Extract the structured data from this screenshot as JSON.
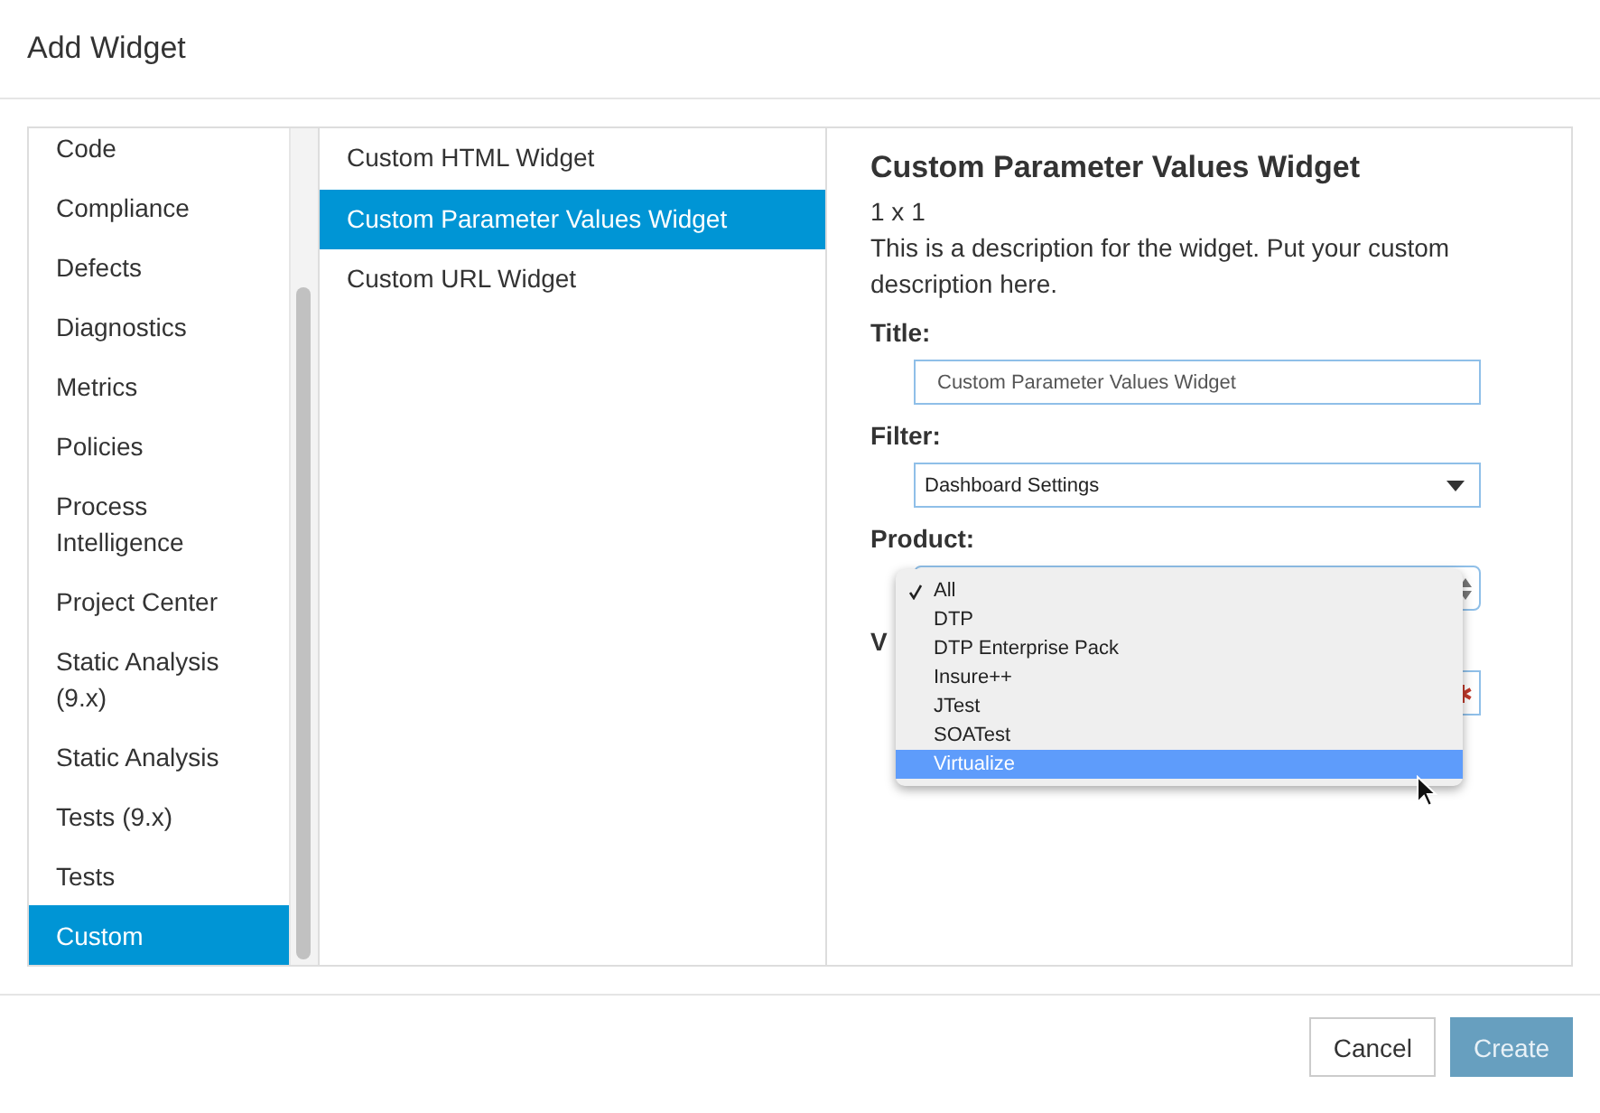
{
  "dialog": {
    "title": "Add Widget"
  },
  "categories": [
    {
      "label": "Code",
      "selected": false
    },
    {
      "label": "Compliance",
      "selected": false
    },
    {
      "label": "Defects",
      "selected": false
    },
    {
      "label": "Diagnostics",
      "selected": false
    },
    {
      "label": "Metrics",
      "selected": false
    },
    {
      "label": "Policies",
      "selected": false
    },
    {
      "label": "Process Intelligence",
      "selected": false
    },
    {
      "label": "Project Center",
      "selected": false
    },
    {
      "label": "Static Analysis (9.x)",
      "selected": false
    },
    {
      "label": "Static Analysis",
      "selected": false
    },
    {
      "label": "Tests (9.x)",
      "selected": false
    },
    {
      "label": "Tests",
      "selected": false
    },
    {
      "label": "Custom",
      "selected": true
    }
  ],
  "widgets": [
    {
      "label": "Custom HTML Widget",
      "selected": false
    },
    {
      "label": "Custom Parameter Values Widget",
      "selected": true
    },
    {
      "label": "Custom URL Widget",
      "selected": false
    }
  ],
  "detail": {
    "name": "Custom Parameter Values Widget",
    "size": "1 x 1",
    "description": "This is a description for the widget. Put your custom description here."
  },
  "form": {
    "title_label": "Title:",
    "title_value": "Custom Parameter Values Widget",
    "filter_label": "Filter:",
    "filter_value": "Dashboard Settings",
    "product_label": "Product:",
    "hidden_label": "V"
  },
  "product_menu": [
    {
      "label": "All",
      "checked": true,
      "selected": false
    },
    {
      "label": "DTP",
      "checked": false,
      "selected": false
    },
    {
      "label": "DTP Enterprise Pack",
      "checked": false,
      "selected": false
    },
    {
      "label": "Insure++",
      "checked": false,
      "selected": false
    },
    {
      "label": "JTest",
      "checked": false,
      "selected": false
    },
    {
      "label": "SOATest",
      "checked": false,
      "selected": false
    },
    {
      "label": "Virtualize",
      "checked": false,
      "selected": true
    }
  ],
  "buttons": [
    {
      "label": "Cancel",
      "kind": "secondary",
      "disabled": false
    },
    {
      "label": "Create",
      "kind": "primary",
      "disabled": true
    }
  ]
}
